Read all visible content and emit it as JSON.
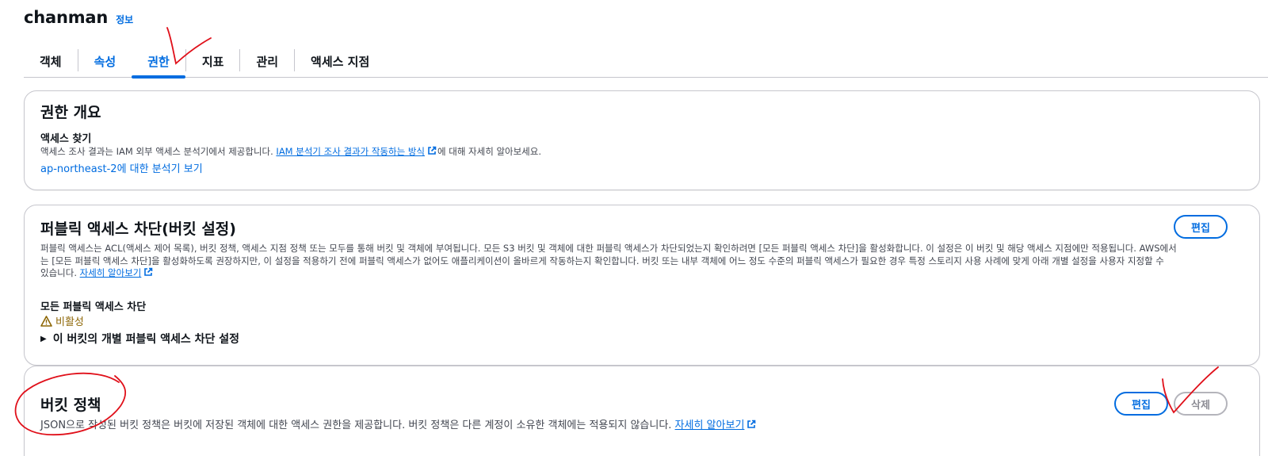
{
  "header": {
    "bucket_name": "chanman",
    "info_label": "정보"
  },
  "tabs": [
    {
      "label": "객체"
    },
    {
      "label": "속성"
    },
    {
      "label": "권한"
    },
    {
      "label": "지표"
    },
    {
      "label": "관리"
    },
    {
      "label": "액세스 지점"
    }
  ],
  "active_tab": "권한",
  "overview": {
    "title": "권한 개요",
    "subheading": "액세스 찾기",
    "description_prefix": "액세스 조사 결과는 IAM 외부 액세스 분석기에서 제공합니다. ",
    "description_link": "IAM 분석기 조사 결과가 작동하는 방식",
    "description_suffix": "에 대해 자세히 알아보세요.",
    "region_link": "ap-northeast-2에 대한 분석기 보기"
  },
  "public_access": {
    "title": "퍼블릭 액세스 차단(버킷 설정)",
    "edit_label": "편집",
    "description_line1": "퍼블릭 액세스는 ACL(액세스 제어 목록), 버킷 정책, 액세스 지점 정책 또는 모두를 통해 버킷 및 객체에 부여됩니다. 모든 S3 버킷 및 객체에 대한 퍼블릭 액세스가 차단되었는지 확인하려면 [모든 퍼블릭 액세스 차단]을 활성화합니다. 이 설정은 이 버킷 및 해당 액세스 지점에만 적용됩니다. AWS에서",
    "description_line2": "는 [모든 퍼블릭 액세스 차단]을 활성화하도록 권장하지만, 이 설정을 적용하기 전에 퍼블릭 액세스가 없어도 애플리케이션이 올바르게 작동하는지 확인합니다. 버킷 또는 내부 객체에 어느 정도 수준의 퍼블릭 액세스가 필요한 경우 특정 스토리지 사용 사례에 맞게 아래 개별 설정을 사용자 지정할 수",
    "description_line3_prefix": "있습니다. ",
    "learn_more": "자세히 알아보기",
    "block_all_label": "모든 퍼블릭 액세스 차단",
    "status_text": "비활성",
    "expand_label": "이 버킷의 개별 퍼블릭 액세스 차단 설정"
  },
  "bucket_policy": {
    "title": "버킷 정책",
    "edit_label": "편집",
    "delete_label": "삭제",
    "description": "JSON으로 작성된 버킷 정책은 버킷에 저장된 객체에 대한 액세스 권한을 제공합니다. 버킷 정책은 다른 계정이 소유한 객체에는 적용되지 않습니다. ",
    "learn_more": "자세히 알아보기"
  },
  "colors": {
    "link_blue": "#006ce0",
    "warning": "#8d6605",
    "annotation_red": "#e0101a",
    "border": "#c6c6cd"
  }
}
